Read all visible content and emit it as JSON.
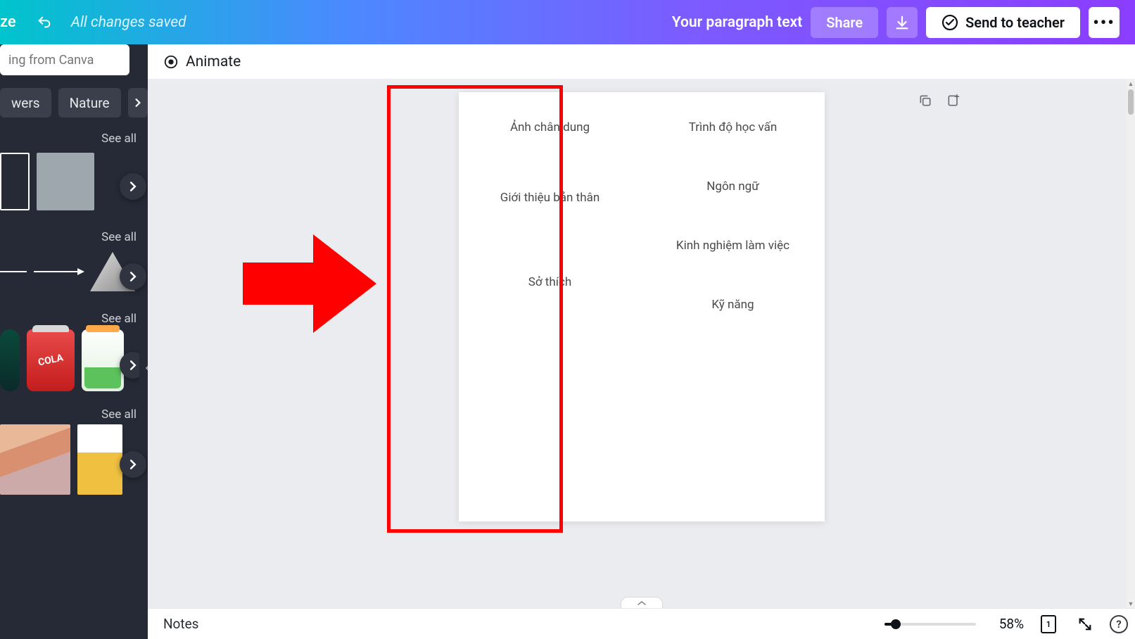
{
  "header": {
    "resize_fragment": "ze",
    "save_status": "All changes saved",
    "title": "Your paragraph text",
    "share_label": "Share",
    "send_teacher_label": "Send to teacher"
  },
  "sidebar": {
    "search_placeholder": "ing from Canva",
    "chips": {
      "flowers": "wers",
      "nature": "Nature"
    },
    "see_all": "See all",
    "soda_label": "COLA"
  },
  "toolbar": {
    "animate": "Animate"
  },
  "canvas": {
    "left_column": {
      "c0": "Ảnh chân dung",
      "c1": "Giới thiệu bản thân",
      "c2": "Sở thích"
    },
    "right_column": {
      "c0": "Trình độ học vấn",
      "c1": "Ngôn ngữ",
      "c2": "Kinh nghiệm làm việc",
      "c3": "Kỹ năng"
    }
  },
  "bottom": {
    "notes": "Notes",
    "zoom": "58%",
    "page_count": "1",
    "help": "?"
  }
}
